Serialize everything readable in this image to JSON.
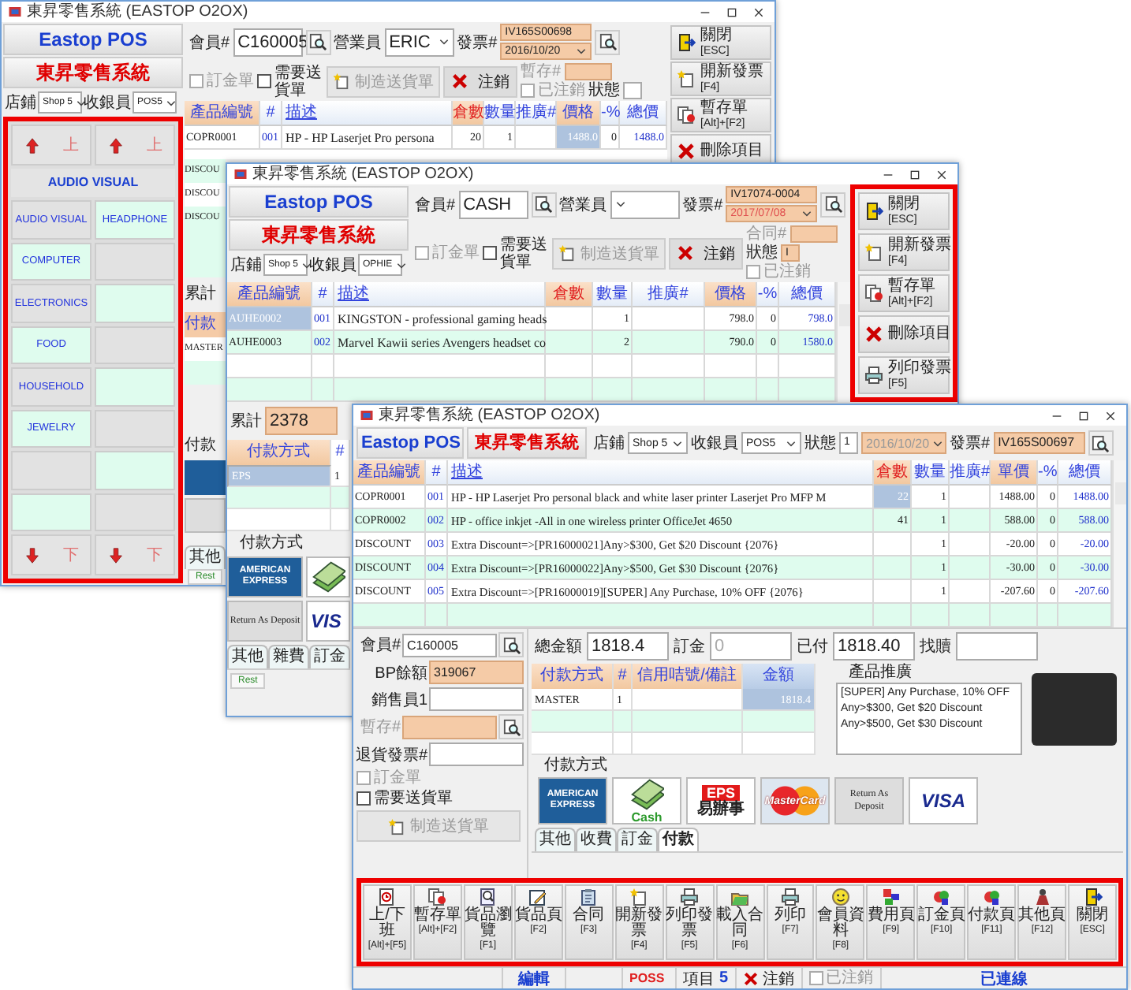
{
  "windows": [
    {
      "kind": "back",
      "title": "東昇零售系統 (EASTOP O2OX)",
      "logo": "Eastop POS",
      "system_name": "東昇零售系統",
      "store": {
        "label": "店鋪",
        "value": "Shop 5"
      },
      "cashier": {
        "label": "收銀員",
        "value": "POS5"
      },
      "category_panel": {
        "highlighted": true,
        "up_buttons": [
          "上",
          "上"
        ],
        "heading": "AUDIO VISUAL",
        "down_buttons": [
          "下",
          "下"
        ],
        "categories": [
          {
            "kind": "category",
            "label": "AUDIO VISUAL"
          },
          {
            "kind": "category",
            "label": "HEADPHONE"
          },
          {
            "kind": "category",
            "label": "COMPUTER"
          },
          {
            "kind": "blank"
          },
          {
            "kind": "category",
            "label": "ELECTRONICS"
          },
          {
            "kind": "blank"
          },
          {
            "kind": "category",
            "label": "FOOD"
          },
          {
            "kind": "blank"
          },
          {
            "kind": "category",
            "label": "HOUSEHOLD"
          },
          {
            "kind": "blank"
          },
          {
            "kind": "category",
            "label": "JEWELRY"
          },
          {
            "kind": "blank"
          },
          {
            "kind": "blank"
          },
          {
            "kind": "blank"
          },
          {
            "kind": "blank"
          },
          {
            "kind": "blank"
          }
        ]
      },
      "member": {
        "label": "會員#",
        "value": "C160005"
      },
      "salesperson": {
        "label": "營業員",
        "value": "ERIC"
      },
      "invoice": {
        "label": "發票#",
        "value": "IV165S00698",
        "date": "2016/10/20"
      },
      "deposit_order": {
        "label": "訂金單",
        "checked": false,
        "disabled": true
      },
      "needs_delivery": {
        "label": "需要送貨單",
        "checked": false,
        "disabled": false
      },
      "delivery_button": {
        "label": "制造送貨單",
        "disabled": true
      },
      "void_button": {
        "label": "注銷"
      },
      "hold": {
        "label": "暫存#"
      },
      "voided": {
        "label": "已注銷",
        "checked": false,
        "disabled": true
      },
      "status": {
        "label": "狀態"
      },
      "columns": [
        {
          "kind": "code",
          "label": "產品編號"
        },
        {
          "kind": "index",
          "label": "#"
        },
        {
          "kind": "description",
          "label": "描述"
        },
        {
          "kind": "stock",
          "label": "倉數"
        },
        {
          "kind": "qty",
          "label": "數量"
        },
        {
          "kind": "promo",
          "label": "推廣#"
        },
        {
          "kind": "price",
          "label": "價格"
        },
        {
          "kind": "discount",
          "label": "-%"
        },
        {
          "kind": "total",
          "label": "總價"
        }
      ],
      "rows": [
        {
          "code": "COPR0001",
          "index": "001",
          "description": "HP - HP Laserjet Pro persona",
          "stock": "20",
          "qty": "1",
          "price": {
            "value": "1488.0",
            "highlighted": true
          },
          "discount": "0",
          "total": "1488.0"
        }
      ],
      "side": {
        "codes": [
          "DISCOU",
          "DISCOU",
          "DISCOU"
        ],
        "total_label": "累計",
        "payment_header": "付款",
        "payment_row": "MASTER",
        "payment_group": "付款",
        "tab": "其他",
        "rest_button": "Rest"
      },
      "side_buttons": {
        "buttons": [
          {
            "kind": "exit",
            "label": "關閉",
            "key": "[ESC]"
          },
          {
            "kind": "newdoc",
            "label": "開新發票",
            "key": "[F4]"
          },
          {
            "kind": "hold",
            "label": "暫存單",
            "key": "[Alt]+[F2]"
          },
          {
            "kind": "cross",
            "label": "刪除項目"
          }
        ]
      }
    },
    {
      "kind": "middle",
      "title": "東昇零售系統 (EASTOP O2OX)",
      "logo": "Eastop POS",
      "system_name": "東昇零售系統",
      "store": {
        "label": "店鋪",
        "value": "Shop 5"
      },
      "cashier": {
        "label": "收銀員",
        "value": "OPHIE"
      },
      "member": {
        "label": "會員#",
        "value": "CASH"
      },
      "salesperson": {
        "label": "營業員"
      },
      "invoice": {
        "label": "發票#",
        "value": "IV17074-0004",
        "date": "2017/07/08"
      },
      "deposit_order": {
        "label": "訂金單",
        "checked": false,
        "disabled": true
      },
      "needs_delivery": {
        "label": "需要送貨單",
        "checked": false,
        "disabled": false
      },
      "delivery_button": {
        "label": "制造送貨單",
        "disabled": true
      },
      "void_button": {
        "label": "注銷"
      },
      "contract": {
        "label": "合同#"
      },
      "voided": {
        "label": "已注銷",
        "checked": false,
        "disabled": true
      },
      "status": {
        "label": "狀態",
        "value": "I"
      },
      "columns": [
        {
          "kind": "code",
          "label": "產品編號"
        },
        {
          "kind": "index",
          "label": "#"
        },
        {
          "kind": "description",
          "label": "描述"
        },
        {
          "kind": "stock",
          "label": "倉數"
        },
        {
          "kind": "qty",
          "label": "數量"
        },
        {
          "kind": "promo",
          "label": "推廣#"
        },
        {
          "kind": "price",
          "label": "價格"
        },
        {
          "kind": "discount",
          "label": "-%"
        },
        {
          "kind": "total",
          "label": "總價"
        }
      ],
      "rows": [
        {
          "code": {
            "value": "AUHE0002",
            "highlighted": true
          },
          "index": "001",
          "description": "KINGSTON - professional gaming heads",
          "qty": "1",
          "price": "798.0",
          "discount": "0",
          "total": "798.0"
        },
        {
          "code": "AUHE0003",
          "index": "002",
          "description": "Marvel Kawii series Avengers headset co",
          "qty": "2",
          "price": "790.0",
          "discount": "0",
          "total": "1580.0"
        }
      ],
      "total": {
        "label": "累計",
        "value": "2378"
      },
      "payment_table": {
        "columns": [
          "付款方式",
          "#"
        ],
        "rows": [
          {
            "method": "EPS",
            "count": "1",
            "selected": true
          }
        ]
      },
      "payment_methods": {
        "label": "付款方式",
        "cards": [
          {
            "kind": "amex",
            "label": "AMERICAN EXPRESS"
          },
          {
            "kind": "cash"
          },
          {
            "kind": "text",
            "label": "Return As Deposit"
          },
          {
            "kind": "visa",
            "label": "VIS"
          }
        ]
      },
      "tabs": [
        {
          "label": "其他",
          "selected": false
        },
        {
          "label": "雜費",
          "selected": false
        },
        {
          "label": "訂金",
          "selected": false
        }
      ],
      "rest_button": "Rest",
      "side_buttons": {
        "highlighted": true,
        "buttons": [
          {
            "kind": "exit",
            "label": "關閉",
            "key": "[ESC]"
          },
          {
            "kind": "newdoc",
            "label": "開新發票",
            "key": "[F4]"
          },
          {
            "kind": "hold",
            "label": "暫存單",
            "key": "[Alt]+[F2]"
          },
          {
            "kind": "cross",
            "label": "刪除項目"
          },
          {
            "kind": "printer",
            "label": "列印發票",
            "key": "[F5]"
          }
        ]
      }
    },
    {
      "kind": "front",
      "title": "東昇零售系統 (EASTOP O2OX)",
      "logo": "Eastop POS",
      "system_name": "東昇零售系統",
      "store": {
        "label": "店鋪",
        "value": "Shop 5"
      },
      "cashier": {
        "label": "收銀員",
        "value": "POS5"
      },
      "status": {
        "label": "狀態",
        "value": "1"
      },
      "date": "2016/10/20",
      "invoice": {
        "label": "發票#",
        "value": "IV165S00697"
      },
      "columns": [
        {
          "kind": "code",
          "label": "產品編號"
        },
        {
          "kind": "index",
          "label": "#"
        },
        {
          "kind": "description",
          "label": "描述"
        },
        {
          "kind": "stock",
          "label": "倉數"
        },
        {
          "kind": "qty",
          "label": "數量"
        },
        {
          "kind": "promo",
          "label": "推廣#"
        },
        {
          "kind": "price",
          "label": "單價"
        },
        {
          "kind": "discount",
          "label": "-%"
        },
        {
          "kind": "total",
          "label": "總價"
        }
      ],
      "rows": [
        {
          "code": "COPR0001",
          "index": "001",
          "description": "HP - HP Laserjet Pro personal black and white laser printer Laserjet Pro MFP M",
          "stock": {
            "value": "22",
            "highlighted": true
          },
          "qty": "1",
          "price": "1488.00",
          "discount": "0",
          "total": "1488.00"
        },
        {
          "code": "COPR0002",
          "index": "002",
          "description": "HP - office inkjet -All in one wireless printer OfficeJet 4650",
          "stock": "41",
          "qty": "1",
          "price": "588.00",
          "discount": "0",
          "total": "588.00"
        },
        {
          "code": "DISCOUNT",
          "index": "003",
          "description": "Extra Discount=>[PR16000021]Any>$300, Get $20 Discount {2076}",
          "qty": "1",
          "price": "-20.00",
          "discount": "0",
          "total": "-20.00"
        },
        {
          "code": "DISCOUNT",
          "index": "004",
          "description": "Extra Discount=>[PR16000022]Any>$500, Get $30 Discount {2076}",
          "qty": "1",
          "price": "-30.00",
          "discount": "0",
          "total": "-30.00"
        },
        {
          "code": "DISCOUNT",
          "index": "005",
          "description": "Extra Discount=>[PR16000019][SUPER] Any Purchase, 10% OFF {2076}",
          "qty": "1",
          "price": "-207.60",
          "discount": "0",
          "total": "-207.60"
        }
      ],
      "form": [
        {
          "label": "會員#",
          "value": "C160005",
          "search": true
        },
        {
          "label": "BP餘額",
          "value": "319067",
          "shaded": true
        },
        {
          "label": "銷售員1"
        },
        {
          "label": "暫存#",
          "shaded": true,
          "search": true,
          "disabled": true
        },
        {
          "label": "退貨發票#"
        }
      ],
      "deposit_order": {
        "label": "訂金單",
        "checked": false,
        "disabled": true
      },
      "needs_delivery": {
        "label": "需要送貨單",
        "checked": false,
        "disabled": false
      },
      "delivery_button": {
        "label": "制造送貨單",
        "disabled": true
      },
      "totals": [
        {
          "label": "總金額",
          "value": "1818.4"
        },
        {
          "label": "訂金",
          "value": "0",
          "disabled": true
        },
        {
          "label": "已付",
          "value": "1818.40"
        },
        {
          "label": "找贖"
        }
      ],
      "payment_table": {
        "columns": [
          "付款方式",
          "#",
          "信用咭號/備註",
          "金額"
        ],
        "rows": [
          {
            "method": "MASTER",
            "count": "1",
            "amount": "1818.4",
            "selected": false
          }
        ]
      },
      "promotions": {
        "label": "產品推廣",
        "lines": [
          "[SUPER] Any Purchase, 10% OFF",
          "Any>$300, Get $20 Discount",
          "Any>$500, Get $30 Discount"
        ]
      },
      "payment_methods": {
        "label": "付款方式",
        "cards": [
          {
            "kind": "amex",
            "label": "AMERICAN EXPRESS"
          },
          {
            "kind": "cash",
            "label": "Cash"
          },
          {
            "kind": "eps",
            "label": "EPS",
            "sub": "易辦事"
          },
          {
            "kind": "mastercard",
            "label": "MasterCard"
          },
          {
            "kind": "text",
            "label": "Return As Deposit"
          },
          {
            "kind": "visa",
            "label": "VISA"
          }
        ]
      },
      "tabs": [
        {
          "label": "其他",
          "selected": false
        },
        {
          "label": "收費",
          "selected": false
        },
        {
          "label": "訂金",
          "selected": false
        },
        {
          "label": "付款",
          "selected": true
        }
      ],
      "toolbar": {
        "highlighted": true,
        "buttons": [
          {
            "kind": "clock",
            "label": "上/下班",
            "key": "[Alt]+[F5]"
          },
          {
            "kind": "hold",
            "label": "暫存單",
            "key": "[Alt]+[F2]"
          },
          {
            "kind": "browse",
            "label": "貨品瀏覽",
            "key": "[F1]"
          },
          {
            "kind": "edit",
            "label": "貨品頁",
            "key": "[F2]"
          },
          {
            "kind": "contract",
            "label": "合同",
            "key": "[F3]"
          },
          {
            "kind": "newdoc",
            "label": "開新發票",
            "key": "[F4]"
          },
          {
            "kind": "printer",
            "label": "列印發票",
            "key": "[F5]"
          },
          {
            "kind": "folder",
            "label": "載入合同",
            "key": "[F6]"
          },
          {
            "kind": "printer",
            "label": "列印",
            "key": "[F7]"
          },
          {
            "kind": "smiley",
            "label": "會員資料",
            "key": "[F8]"
          },
          {
            "kind": "fee",
            "label": "費用頁",
            "key": "[F9]"
          },
          {
            "kind": "deposit",
            "label": "訂金頁",
            "key": "[F10]"
          },
          {
            "kind": "deposit",
            "label": "付款頁",
            "key": "[F11]"
          },
          {
            "kind": "person",
            "label": "其他頁",
            "key": "[F12]"
          },
          {
            "kind": "exit",
            "label": "關閉",
            "key": "[ESC]"
          }
        ]
      },
      "status_bar": {
        "mode": "編輯",
        "user": "POSS",
        "items_label": "項目",
        "items_count": "5",
        "void": "注銷",
        "voided": {
          "label": "已注銷",
          "checked": false,
          "disabled": true
        },
        "connection": "已連線"
      }
    }
  ]
}
